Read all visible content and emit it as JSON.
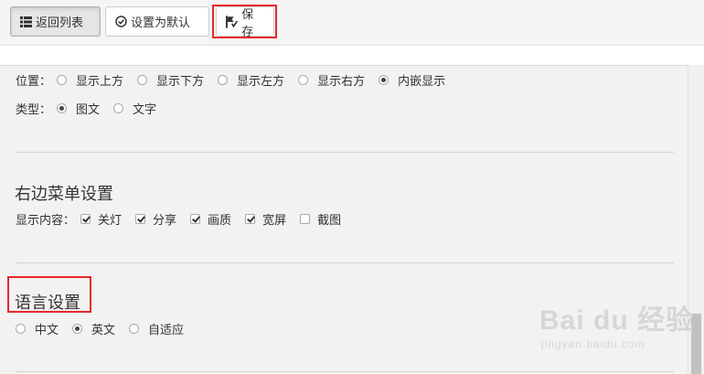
{
  "toolbar": {
    "back_label": "返回列表",
    "set_default_label": "设置为默认",
    "save_label": "保存"
  },
  "position": {
    "label": "位置：",
    "options": [
      "显示上方",
      "显示下方",
      "显示左方",
      "显示右方",
      "内嵌显示"
    ],
    "selected": "内嵌显示"
  },
  "type": {
    "label": "类型：",
    "options": [
      "图文",
      "文字"
    ],
    "selected": "图文"
  },
  "right_menu": {
    "title": "右边菜单设置",
    "content_label": "显示内容：",
    "items": [
      {
        "label": "关灯",
        "checked": true
      },
      {
        "label": "分享",
        "checked": true
      },
      {
        "label": "画质",
        "checked": true
      },
      {
        "label": "宽屏",
        "checked": true
      },
      {
        "label": "截图",
        "checked": false
      }
    ]
  },
  "language": {
    "title": "语言设置",
    "options": [
      "中文",
      "英文",
      "自适应"
    ],
    "selected": "英文"
  },
  "watermark": {
    "main": "Bai du 经验",
    "sub": "jingyan.baidu.com"
  },
  "colors": {
    "highlight": "#e8262b",
    "panel_bg": "#f2f2f2"
  }
}
